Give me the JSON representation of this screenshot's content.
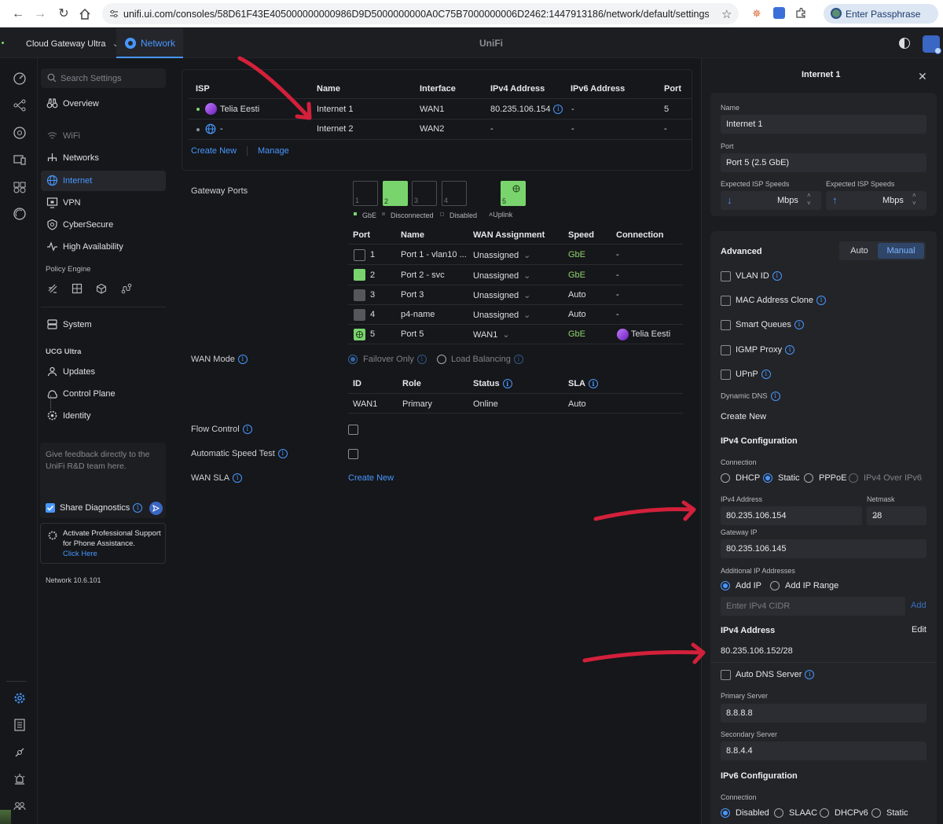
{
  "browser": {
    "url": "unifi.ui.com/consoles/58D61F43E405000000000986D9D5000000000A0C75B7000000006D2462:1447913186/network/default/settings/int...",
    "passphrase_button": "Enter Passphrase"
  },
  "header": {
    "console": "Cloud Gateway Ultra",
    "app_tab": "Network",
    "brand": "UniFi"
  },
  "sidebar": {
    "search_placeholder": "Search Settings",
    "items": [
      {
        "label": "Overview",
        "icon": "binoculars-icon"
      },
      {
        "label": "WiFi",
        "icon": "wifi-icon"
      },
      {
        "label": "Networks",
        "icon": "network-tree-icon"
      },
      {
        "label": "Internet",
        "icon": "globe-icon"
      },
      {
        "label": "VPN",
        "icon": "vpn-icon"
      },
      {
        "label": "CyberSecure",
        "icon": "shield-icon"
      },
      {
        "label": "High Availability",
        "icon": "heartbeat-icon"
      }
    ],
    "policy_engine": "Policy Engine",
    "system": "System",
    "ucg_section": "UCG Ultra",
    "ucg_items": [
      "Updates",
      "Control Plane",
      "Identity"
    ],
    "feedback": "Give feedback directly to the UniFi R&D team here.",
    "share_diagnostics": "Share Diagnostics",
    "support_text": "Activate Professional Support for Phone Assistance.",
    "support_link": "Click Here",
    "version": "Network 10.6.101"
  },
  "isp_table": {
    "headers": [
      "ISP",
      "Name",
      "Interface",
      "IPv4 Address",
      "IPv6 Address",
      "Port"
    ],
    "rows": [
      {
        "isp": "Telia Eesti",
        "name": "Internet 1",
        "interface": "WAN1",
        "ipv4": "80.235.106.154",
        "ipv6": "-",
        "port": "5"
      },
      {
        "isp": "-",
        "name": "Internet 2",
        "interface": "WAN2",
        "ipv4": "-",
        "ipv6": "-",
        "port": "-"
      }
    ],
    "create_new": "Create New",
    "manage": "Manage"
  },
  "gateway_ports": {
    "label": "Gateway Ports",
    "port_numbers": [
      "1",
      "2",
      "3",
      "4",
      "5"
    ],
    "legend": [
      "GbE",
      "Disconnected",
      "Disabled",
      "Uplink"
    ],
    "headers": [
      "Port",
      "Name",
      "WAN Assignment",
      "Speed",
      "Connection"
    ],
    "rows": [
      {
        "port": "1",
        "name": "Port 1 - vlan10 ...",
        "wan": "Unassigned",
        "speed": "GbE",
        "connection": "-"
      },
      {
        "port": "2",
        "name": "Port 2 - svc",
        "wan": "Unassigned",
        "speed": "GbE",
        "connection": "-"
      },
      {
        "port": "3",
        "name": "Port 3",
        "wan": "Unassigned",
        "speed": "Auto",
        "connection": "-"
      },
      {
        "port": "4",
        "name": "p4-name",
        "wan": "Unassigned",
        "speed": "Auto",
        "connection": "-"
      },
      {
        "port": "5",
        "name": "Port 5",
        "wan": "WAN1",
        "speed": "GbE",
        "connection": "Telia Eesti"
      }
    ]
  },
  "wan_mode": {
    "label": "WAN Mode",
    "options": [
      "Failover Only",
      "Load Balancing"
    ],
    "headers": [
      "ID",
      "Role",
      "Status",
      "SLA"
    ],
    "row": {
      "id": "WAN1",
      "role": "Primary",
      "status": "Online",
      "sla": "Auto"
    }
  },
  "settings": {
    "flow_control": "Flow Control",
    "auto_speed_test": "Automatic Speed Test",
    "wan_sla": "WAN SLA",
    "create_new": "Create New"
  },
  "panel": {
    "title": "Internet 1",
    "name_label": "Name",
    "name_value": "Internet 1",
    "port_label": "Port",
    "port_value": "Port 5 (2.5 GbE)",
    "speed_label": "Expected ISP Speeds",
    "unit": "Mbps",
    "advanced": "Advanced",
    "mode_auto": "Auto",
    "mode_manual": "Manual",
    "checks": [
      "VLAN ID",
      "MAC Address Clone",
      "Smart Queues",
      "IGMP Proxy",
      "UPnP"
    ],
    "dynamic_dns": "Dynamic DNS",
    "create_new": "Create New",
    "ipv4_config": "IPv4 Configuration",
    "connection_label": "Connection",
    "conn_options": [
      "DHCP",
      "Static",
      "PPPoE",
      "IPv4 Over IPv6"
    ],
    "ipv4_label": "IPv4 Address",
    "ipv4_value": "80.235.106.154",
    "netmask_label": "Netmask",
    "netmask_value": "28",
    "gateway_label": "Gateway IP",
    "gateway_value": "80.235.106.145",
    "additional_label": "Additional IP Addresses",
    "add_ip": "Add IP",
    "add_range": "Add IP Range",
    "cidr_placeholder": "Enter IPv4 CIDR",
    "add": "Add",
    "ipv4_address_title": "IPv4 Address",
    "edit": "Edit",
    "ipv4_cidr": "80.235.106.152/28",
    "auto_dns": "Auto DNS Server",
    "primary_label": "Primary Server",
    "primary_value": "8.8.8.8",
    "secondary_label": "Secondary Server",
    "secondary_value": "8.8.4.4",
    "ipv6_config": "IPv6 Configuration",
    "connection_label2": "Connection",
    "ipv6_options": [
      "Disabled",
      "SLAAC",
      "DHCPv6",
      "Static"
    ]
  },
  "colors": {
    "accent": "#4797ff",
    "green": "#7fd46b",
    "annotation": "#d3203b",
    "telia": "#9b3fe0"
  }
}
